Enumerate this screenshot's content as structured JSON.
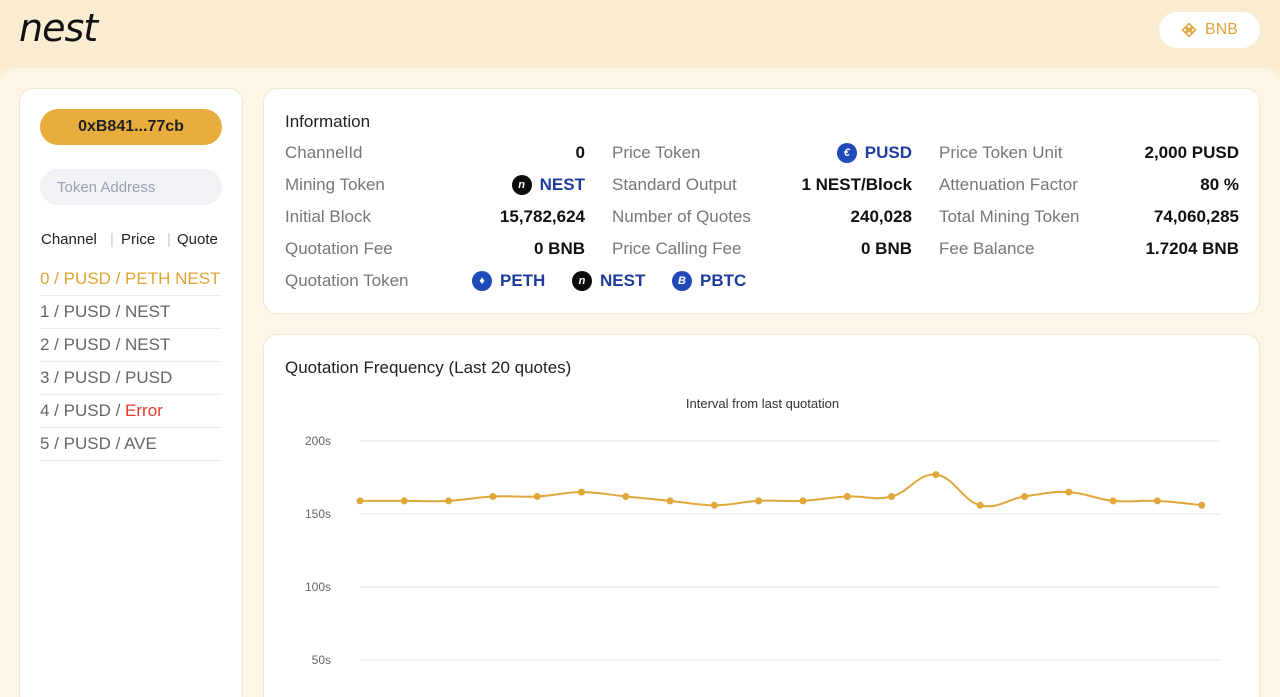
{
  "header": {
    "logo": "nest",
    "network_label": "BNB",
    "network_icon": "bnb-icon"
  },
  "sidebar": {
    "address": "0xB841...77cb",
    "token_placeholder": "Token Address",
    "columns": [
      "Channel",
      "Price",
      "Quote"
    ],
    "channels": [
      {
        "prefix": "0 / PUSD / PETH NEST",
        "suffix": "",
        "active": true
      },
      {
        "prefix": "1 / PUSD / NEST",
        "suffix": ""
      },
      {
        "prefix": "2 / PUSD / NEST",
        "suffix": ""
      },
      {
        "prefix": "3 / PUSD / PUSD",
        "suffix": ""
      },
      {
        "prefix": "4 / PUSD / ",
        "suffix": "Error"
      },
      {
        "prefix": "5 / PUSD / AVE",
        "suffix": ""
      }
    ]
  },
  "info": {
    "title": "Information",
    "rows": [
      {
        "label": "ChannelId",
        "value": "0"
      },
      {
        "label": "Price Token",
        "value": "PUSD",
        "icon": "pusd-icon"
      },
      {
        "label": "Price Token Unit",
        "value": "2,000 PUSD"
      },
      {
        "label": "Mining Token",
        "value": "NEST",
        "icon": "nest-icon"
      },
      {
        "label": "Standard Output",
        "value": "1 NEST/Block"
      },
      {
        "label": "Attenuation Factor",
        "value": "80 %"
      },
      {
        "label": "Initial Block",
        "value": "15,782,624"
      },
      {
        "label": "Number of Quotes",
        "value": "240,028"
      },
      {
        "label": "Total Mining Token",
        "value": "74,060,285"
      },
      {
        "label": "Quotation Fee",
        "value": "0 BNB"
      },
      {
        "label": "Price Calling Fee",
        "value": "0 BNB"
      },
      {
        "label": "Fee Balance",
        "value": "1.7204 BNB"
      }
    ],
    "quotation_label": "Quotation Token",
    "quotation_tokens": [
      {
        "name": "PETH",
        "icon": "eth-icon"
      },
      {
        "name": "NEST",
        "icon": "nest-icon"
      },
      {
        "name": "PBTC",
        "icon": "btc-icon"
      }
    ]
  },
  "frequency": {
    "title": "Quotation Frequency (Last 20 quotes)"
  },
  "chart_data": {
    "type": "line",
    "title": "Interval from last quotation",
    "xlabel": "",
    "ylabel": "",
    "y_ticks": [
      "200s",
      "150s",
      "100s",
      "50s"
    ],
    "ylim": [
      0,
      200
    ],
    "grid": true,
    "color": "#e0a83a",
    "series": [
      {
        "values": [
          159,
          159,
          159,
          162,
          162,
          165,
          162,
          159,
          156,
          159,
          159,
          162,
          162,
          177,
          156,
          162,
          165,
          159,
          159,
          156
        ]
      }
    ]
  }
}
